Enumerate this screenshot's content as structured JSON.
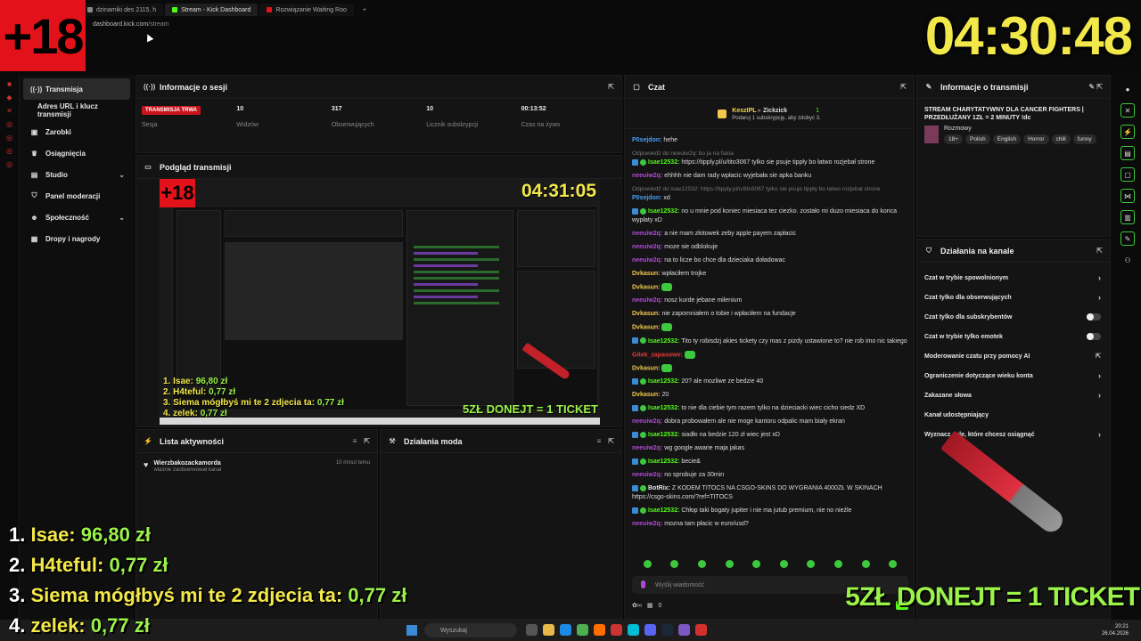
{
  "browser": {
    "tabs": [
      {
        "label": "dzinamiki des 2115, h",
        "color": "#888888"
      },
      {
        "label": "Stream - Kick Dashboard",
        "color": "#53fc18"
      },
      {
        "label": "Rozwiązanie Waiting Roo",
        "color": "#e3121a"
      }
    ],
    "new_tab": "+",
    "url_host": "dashboard.kick.com",
    "url_path": "/stream"
  },
  "overlay": {
    "age_badge": "+18",
    "timer": "04:30:48",
    "donors": [
      {
        "rank": "1.",
        "name": "Isae:",
        "amount": "96,80 zł"
      },
      {
        "rank": "2.",
        "name": "H4teful:",
        "amount": "0,77 zł"
      },
      {
        "rank": "3.",
        "name": "Siema mógłbyś mi te 2 zdjecia ta:",
        "amount": "0,77 zł"
      },
      {
        "rank": "4.",
        "name": "zelek:",
        "amount": "0,77 zł"
      }
    ],
    "ticket_text": "5ZŁ DONEJT = 1 TICKET"
  },
  "sidebar": {
    "items": [
      {
        "label": "Transmisja",
        "icon": "broadcast-icon",
        "glyph": "((·))"
      },
      {
        "label": "Adres URL i klucz transmisji",
        "icon": "",
        "glyph": ""
      },
      {
        "label": "Zarobki",
        "icon": "wallet-icon",
        "glyph": "▣"
      },
      {
        "label": "Osiągnięcia",
        "icon": "trophy-icon",
        "glyph": "♛"
      },
      {
        "label": "Studio",
        "icon": "studio-icon",
        "glyph": "▤"
      },
      {
        "label": "Panel moderacji",
        "icon": "shield-icon",
        "glyph": "⛉"
      },
      {
        "label": "Społeczność",
        "icon": "community-icon",
        "glyph": "☻"
      },
      {
        "label": "Dropy i nagrody",
        "icon": "gift-icon",
        "glyph": "▦"
      }
    ]
  },
  "session": {
    "title": "Informacje o sesji",
    "stats": [
      {
        "value": "TRANSMISJA TRWA",
        "label": "Sesja"
      },
      {
        "value": "10",
        "label": "Widzów"
      },
      {
        "value": "317",
        "label": "Obserwujących"
      },
      {
        "value": "10",
        "label": "Licznik subskrypcji"
      },
      {
        "value": "00:13:52",
        "label": "Czas na żywo"
      }
    ]
  },
  "preview": {
    "title": "Podgląd transmisji",
    "age_badge": "+18",
    "timer": "04:31:05",
    "donors": [
      {
        "name": "1. Isae:",
        "amount": "96,80 zł"
      },
      {
        "name": "2. H4teful:",
        "amount": "0,77 zł"
      },
      {
        "name": "3. Siema mógłbyś mi te 2 zdjecia ta:",
        "amount": "0,77 zł"
      },
      {
        "name": "4. zelek:",
        "amount": "0,77 zł"
      }
    ],
    "ticket_text": "5ZŁ DONEJT = 1 TICKET"
  },
  "activity": {
    "title": "Lista aktywności",
    "items": [
      {
        "user": "Wierzbakozackamorda",
        "action": "właśnie zaobserwował kanał",
        "time": "10 minut temu"
      }
    ]
  },
  "mod_actions": {
    "title": "Działania moda"
  },
  "chat": {
    "title": "Czat",
    "pinned_user1": "KeszIPL",
    "pinned_user2": "Zickzick",
    "pinned_count": "1",
    "pinned_text": "Podaruj 1 subskrypcję, aby zdobyć 3.",
    "messages": [
      {
        "reply": "",
        "user": "P0sejdon:",
        "color": "#4a9ef0",
        "text": "hehe",
        "badge": "none"
      },
      {
        "reply": "Odpowiedź do neeuiw2q: bo ja na fiana",
        "user": "Isae12532:",
        "color": "#53fc18",
        "text": "https://tipply.pl/u/tito3067 tylko sie psuje tippły bo łatwo rozjebał strone",
        "badge": "sub"
      },
      {
        "reply": "",
        "user": "neeuiw2q:",
        "color": "#b04ad6",
        "text": "ehhhh nie dam rady wpłacic wyjebała sie apka banku",
        "badge": "none"
      },
      {
        "reply": "Odpowiedź do isae12532: https://tipply.pl/u/tito3067 tylko sie psuje tippły bo łatwo rozjebał strone",
        "user": "P0sejdon:",
        "color": "#4a9ef0",
        "text": "xd",
        "badge": "none"
      },
      {
        "reply": "",
        "user": "Isae12532:",
        "color": "#53fc18",
        "text": "no u mnie pod koniec miesiaca tez ciezko. zostało mi duzo miesiaca do konca wypłaty xD",
        "badge": "sub"
      },
      {
        "reply": "",
        "user": "neeuiw2q:",
        "color": "#b04ad6",
        "text": "a nie mam złotowek zeby apple payem zapłacic",
        "badge": "none"
      },
      {
        "reply": "",
        "user": "neeuiw2q:",
        "color": "#b04ad6",
        "text": "moze sie odblokuje",
        "badge": "none"
      },
      {
        "reply": "",
        "user": "neeuiw2q:",
        "color": "#b04ad6",
        "text": "na to licze bo chce dla dzieciaka doładowac",
        "badge": "none"
      },
      {
        "reply": "",
        "user": "Dvkasun:",
        "color": "#f3c84a",
        "text": "wpłaciłem trojke",
        "badge": "none"
      },
      {
        "reply": "",
        "user": "Dvkasun:",
        "color": "#f3c84a",
        "text": "",
        "badge": "none"
      },
      {
        "reply": "",
        "user": "neeuiw2q:",
        "color": "#b04ad6",
        "text": "nosz kurde jebane milenium",
        "badge": "none"
      },
      {
        "reply": "",
        "user": "Dvkasun:",
        "color": "#f3c84a",
        "text": "nie zapomniałem o tobie i wpłaciłem na fundacje",
        "badge": "none"
      },
      {
        "reply": "",
        "user": "Dvkasun:",
        "color": "#f3c84a",
        "text": "",
        "badge": "none"
      },
      {
        "reply": "",
        "user": "Isae12532:",
        "color": "#53fc18",
        "text": "Tito ty robisdzj akies tickety czy mas z pizdy ustawione to? nie rob imo nic takiego",
        "badge": "sub"
      },
      {
        "reply": "",
        "user": "Gitek_zapasowe:",
        "color": "#e03a3a",
        "text": "",
        "badge": "none"
      },
      {
        "reply": "",
        "user": "Dvkasun:",
        "color": "#f3c84a",
        "text": "",
        "badge": "none"
      },
      {
        "reply": "",
        "user": "Isae12532:",
        "color": "#53fc18",
        "text": "20? ale mozliwe ze bedzie 40",
        "badge": "sub"
      },
      {
        "reply": "",
        "user": "Dvkasun:",
        "color": "#f3c84a",
        "text": "20",
        "badge": "none"
      },
      {
        "reply": "",
        "user": "Isae12532:",
        "color": "#53fc18",
        "text": "to nie dla ciebie tym razem tylko na dzieciacki wiec cicho siedz XD",
        "badge": "sub"
      },
      {
        "reply": "",
        "user": "neeuiw2q:",
        "color": "#b04ad6",
        "text": "dobra probowałem ale nie moge kantoru odpalic mam biały ekran",
        "badge": "none"
      },
      {
        "reply": "",
        "user": "Isae12532:",
        "color": "#53fc18",
        "text": "siadło na bedzie 120 zł wiec jest xD",
        "badge": "sub"
      },
      {
        "reply": "",
        "user": "neeuiw2q:",
        "color": "#b04ad6",
        "text": "wg google awarie maja jakas",
        "badge": "none"
      },
      {
        "reply": "",
        "user": "Isae12532:",
        "color": "#53fc18",
        "text": "becie&",
        "badge": "sub"
      },
      {
        "reply": "",
        "user": "neeuiw2q:",
        "color": "#b04ad6",
        "text": "no sprobuje za 30min",
        "badge": "none"
      },
      {
        "reply": "",
        "user": "BotRix:",
        "color": "#e6e6e6",
        "text": "Z KODEM TITOCS NA CSGO-SKINS DO WYGRANIA 4000ZŁ W SKINACH https://csgo-skins.com/?ref=TITOCS",
        "badge": "sub"
      },
      {
        "reply": "",
        "user": "Isae12532:",
        "color": "#53fc18",
        "text": "Chłop taki bogaty jupiter i nie ma jutub premium, nie no nieźle",
        "badge": "sub"
      },
      {
        "reply": "",
        "user": "neeuiw2q:",
        "color": "#b04ad6",
        "text": "mozna tam płacic w euro/usd?",
        "badge": "none"
      }
    ],
    "input_placeholder": "Wyślij wiadomość",
    "bottom_count": "0"
  },
  "stream_info": {
    "title": "Informacje o transmisji",
    "stream_title": "STREAM CHARYTATYWNY DLA CANCER FIGHTERS | PRZEDŁUŻANY 1ZŁ = 2 MINUTY !dc",
    "category": "Rozmowy",
    "tags": [
      "18+",
      "Polish",
      "English",
      "Horror",
      "chill",
      "funny"
    ]
  },
  "channel_actions": {
    "title": "Działania na kanale",
    "items": [
      {
        "label": "Czat w trybie spowolnionym",
        "control": "chevron"
      },
      {
        "label": "Czat tylko dla obserwujących",
        "control": "chevron"
      },
      {
        "label": "Czat tylko dla subskrybentów",
        "control": "toggle"
      },
      {
        "label": "Czat w trybie tylko emotek",
        "control": "toggle"
      },
      {
        "label": "Moderowanie czatu przy pomocy AI",
        "control": "external"
      },
      {
        "label": "Ograniczenie dotyczące wieku konta",
        "control": "chevron"
      },
      {
        "label": "Zakazane słowa",
        "control": "chevron"
      },
      {
        "label": "Kanał udostępniający",
        "control": "none"
      },
      {
        "label": "Wyznacz cele, które chcesz osiągnąć",
        "control": "chevron"
      }
    ]
  },
  "taskbar": {
    "search": "Wyszukaj",
    "time": "20:21",
    "date": "26.04.2026"
  }
}
